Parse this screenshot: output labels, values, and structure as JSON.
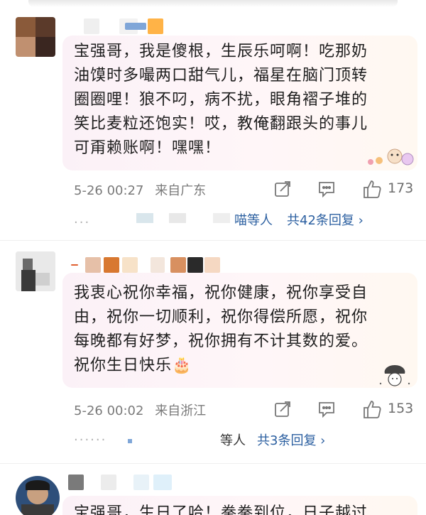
{
  "comments": [
    {
      "text": "宝强哥，我是傻根，生辰乐呵啊！吃那奶\n油馍时多嘬两口甜气儿，福星在脑门顶转\n圈圈哩！狼不叼，病不扰，眼角褶子堆的\n笑比麦粒还饱实！哎，教俺翻跟头的事儿\n可甭赖账啊！嘿嘿！",
      "date": "5-26 00:27",
      "location": "来自广东",
      "like_count": "173",
      "reply_users": "喵等人",
      "reply_link": "共42条回复 ›",
      "reply_dots": "..."
    },
    {
      "text": "我衷心祝你幸福，祝你健康，祝你享受自\n由，祝你一切顺利，祝你得偿所愿，祝你\n每晚都有好梦，祝你拥有不计其数的爱。\n祝你生日快乐🎂",
      "date": "5-26 00:02",
      "location": "来自浙江",
      "like_count": "153",
      "reply_users": "等人",
      "reply_link": "共3条回复 ›",
      "reply_dots": "......"
    },
    {
      "text": "宝强哥，生日了哈！拳拳到位，日子越过"
    }
  ],
  "icons": {
    "share": "share-icon",
    "comment": "comment-icon",
    "like": "thumbs-up-icon"
  },
  "colors": {
    "link": "#2b5fa0",
    "meta": "#7a7a7a",
    "bubble": "#fbf1f7"
  }
}
